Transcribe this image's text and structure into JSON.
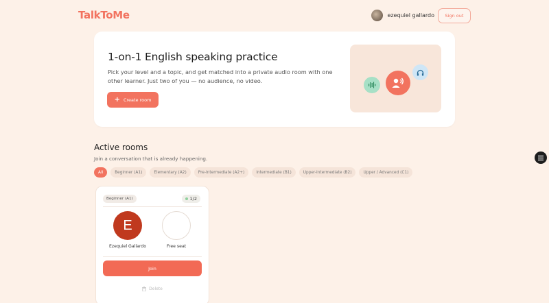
{
  "header": {
    "logo": "TalkToMe",
    "user_name": "ezequiel gallardo",
    "signout_label": "Sign out"
  },
  "hero": {
    "title": "1-on-1 English speaking practice",
    "description": "Pick your level and a topic, and get matched into a private audio room with one other learner. Just two of you — no audience, no video.",
    "create_label": "Create room",
    "illustration_icons": [
      "audio-wave-icon",
      "speaking-person-icon",
      "headphones-icon"
    ]
  },
  "rooms_section": {
    "title": "Active rooms",
    "subtitle": "Join a conversation that is already happening.",
    "filters": [
      "All",
      "Beginner (A1)",
      "Elementary (A2)",
      "Pre-Intermediate (A2+)",
      "Intermediate (B1)",
      "Upper-Intermediate (B2)",
      "Upper / Advanced (C1)"
    ],
    "active_filter": "All"
  },
  "room": {
    "level": "Beginner (A1)",
    "count": "1/2",
    "seat1_initial": "E",
    "seat1_name": "Ezequiel Gallardo",
    "seat2_name": "Free seat",
    "join_label": "Join",
    "delete_label": "Delete"
  },
  "colors": {
    "accent": "#f2735f",
    "background": "#fdf1e8",
    "avatar_red": "#c0391e",
    "green_circle": "#a7e0c6",
    "blue_circle": "#cfe6f6"
  }
}
